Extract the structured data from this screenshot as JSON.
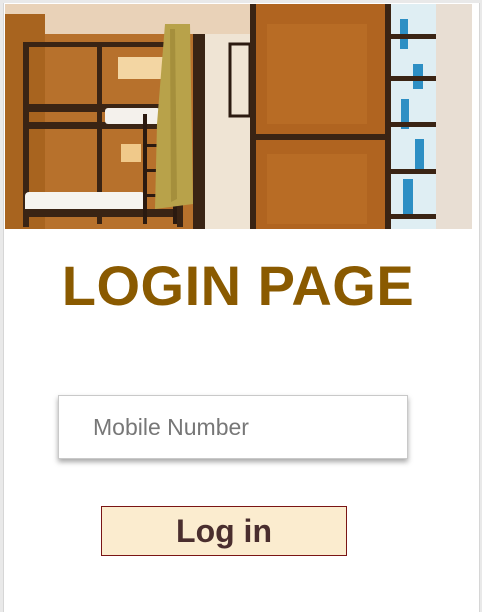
{
  "page": {
    "title": "LOGIN PAGE"
  },
  "form": {
    "mobile_placeholder": "Mobile Number",
    "login_label": "Log in"
  },
  "colors": {
    "title": "#8a5a00",
    "button_bg": "#fbeccf",
    "button_text": "#4a2e2e",
    "button_border": "#7a1515"
  },
  "hero": {
    "image_name": "hostel-bunk-bed-photo"
  }
}
